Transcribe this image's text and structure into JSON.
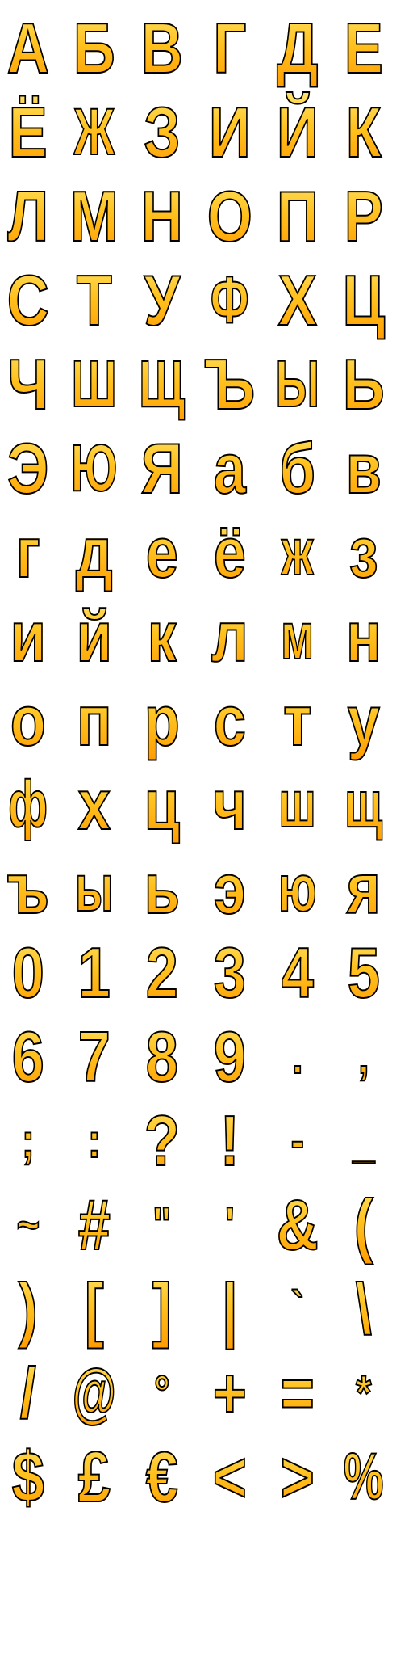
{
  "sheet": {
    "rows": [
      [
        "А",
        "Б",
        "В",
        "Г",
        "Д",
        "Е"
      ],
      [
        "Ё",
        "Ж",
        "З",
        "И",
        "Й",
        "К"
      ],
      [
        "Л",
        "М",
        "Н",
        "О",
        "П",
        "Р"
      ],
      [
        "С",
        "Т",
        "У",
        "Ф",
        "Х",
        "Ц"
      ],
      [
        "Ч",
        "Ш",
        "Щ",
        "Ъ",
        "Ы",
        "Ь"
      ],
      [
        "Э",
        "Ю",
        "Я",
        "а",
        "б",
        "в"
      ],
      [
        "г",
        "д",
        "е",
        "ё",
        "ж",
        "з"
      ],
      [
        "и",
        "й",
        "к",
        "л",
        "м",
        "н"
      ],
      [
        "о",
        "п",
        "р",
        "с",
        "т",
        "у"
      ],
      [
        "ф",
        "х",
        "ц",
        "ч",
        "ш",
        "щ"
      ],
      [
        "ъ",
        "ы",
        "ь",
        "э",
        "ю",
        "я"
      ],
      [
        "0",
        "1",
        "2",
        "3",
        "4",
        "5"
      ],
      [
        "6",
        "7",
        "8",
        "9",
        ".",
        ","
      ],
      [
        ";",
        ":",
        "?",
        "!",
        "-",
        "_"
      ],
      [
        "~",
        "#",
        "\"",
        "'",
        "&",
        "("
      ],
      [
        ")",
        "[",
        "]",
        "|",
        "`",
        "\\"
      ],
      [
        "/",
        "@",
        "°",
        "+",
        "=",
        "*"
      ],
      [
        "$",
        "£",
        "€",
        "<",
        ">",
        "%"
      ]
    ],
    "fill_gradient": [
      "#ffe36b",
      "#ffc21f",
      "#ff9a00"
    ],
    "outline_color": "#000000"
  }
}
